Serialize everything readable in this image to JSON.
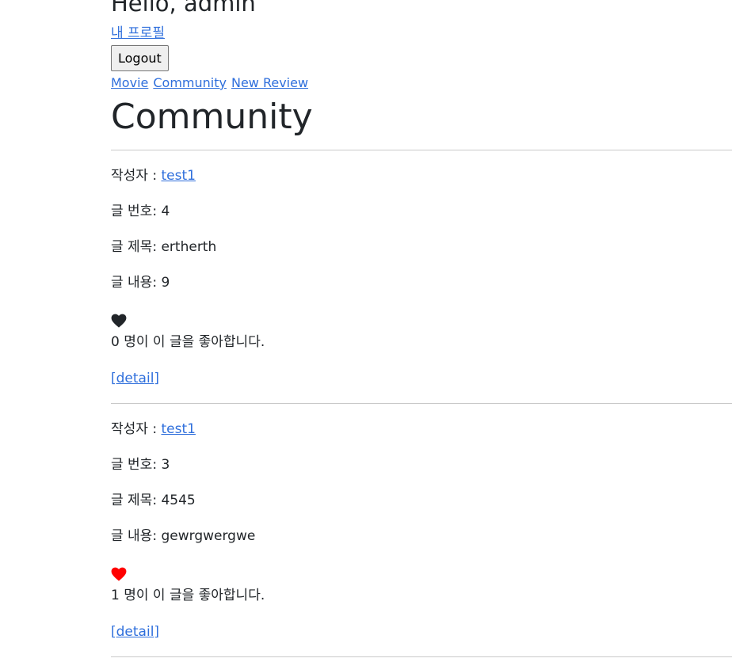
{
  "header": {
    "greeting": "Hello, admin",
    "profile_link": "내 프로필",
    "logout_label": "Logout"
  },
  "nav": {
    "movie": "Movie",
    "community": "Community",
    "new_review": "New Review"
  },
  "page_title": "Community",
  "colors": {
    "link": "#2f6fdc",
    "heart_unliked": "#212529",
    "heart_liked": "#ff0000"
  },
  "posts": [
    {
      "author_label": "작성자 :",
      "author": "test1",
      "number_label": "글 번호:",
      "number": "4",
      "title_label": "글 제목:",
      "title": "ertherth",
      "content_label": "글 내용:",
      "content": "9",
      "liked": false,
      "heart_icon": "heart-icon",
      "like_text": "0 명이 이 글을 좋아합니다.",
      "detail_link": "[detail]"
    },
    {
      "author_label": "작성자 :",
      "author": "test1",
      "number_label": "글 번호:",
      "number": "3",
      "title_label": "글 제목:",
      "title": "4545",
      "content_label": "글 내용:",
      "content": "gewrgwergwe",
      "liked": true,
      "heart_icon": "heart-icon",
      "like_text": "1 명이 이 글을 좋아합니다.",
      "detail_link": "[detail]"
    }
  ]
}
